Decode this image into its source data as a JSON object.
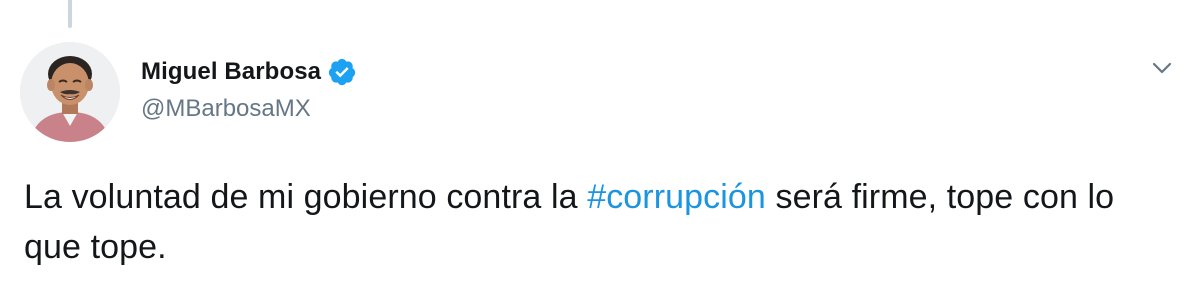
{
  "tweet": {
    "author": {
      "display_name": "Miguel Barbosa",
      "handle": "@MBarbosaMX",
      "verified": true
    },
    "text": {
      "before": "La voluntad de mi gobierno contra la ",
      "hashtag": "#corrupción",
      "after": " será firme, tope con lo que tope."
    }
  },
  "icons": {
    "verified": "verified-badge-icon",
    "menu": "chevron-down-icon"
  },
  "colors": {
    "hashtag": "#1b95e0",
    "verified": "#1da1f2",
    "handle": "#657786",
    "text": "#14171a",
    "thread_line": "#ccd6dd"
  }
}
